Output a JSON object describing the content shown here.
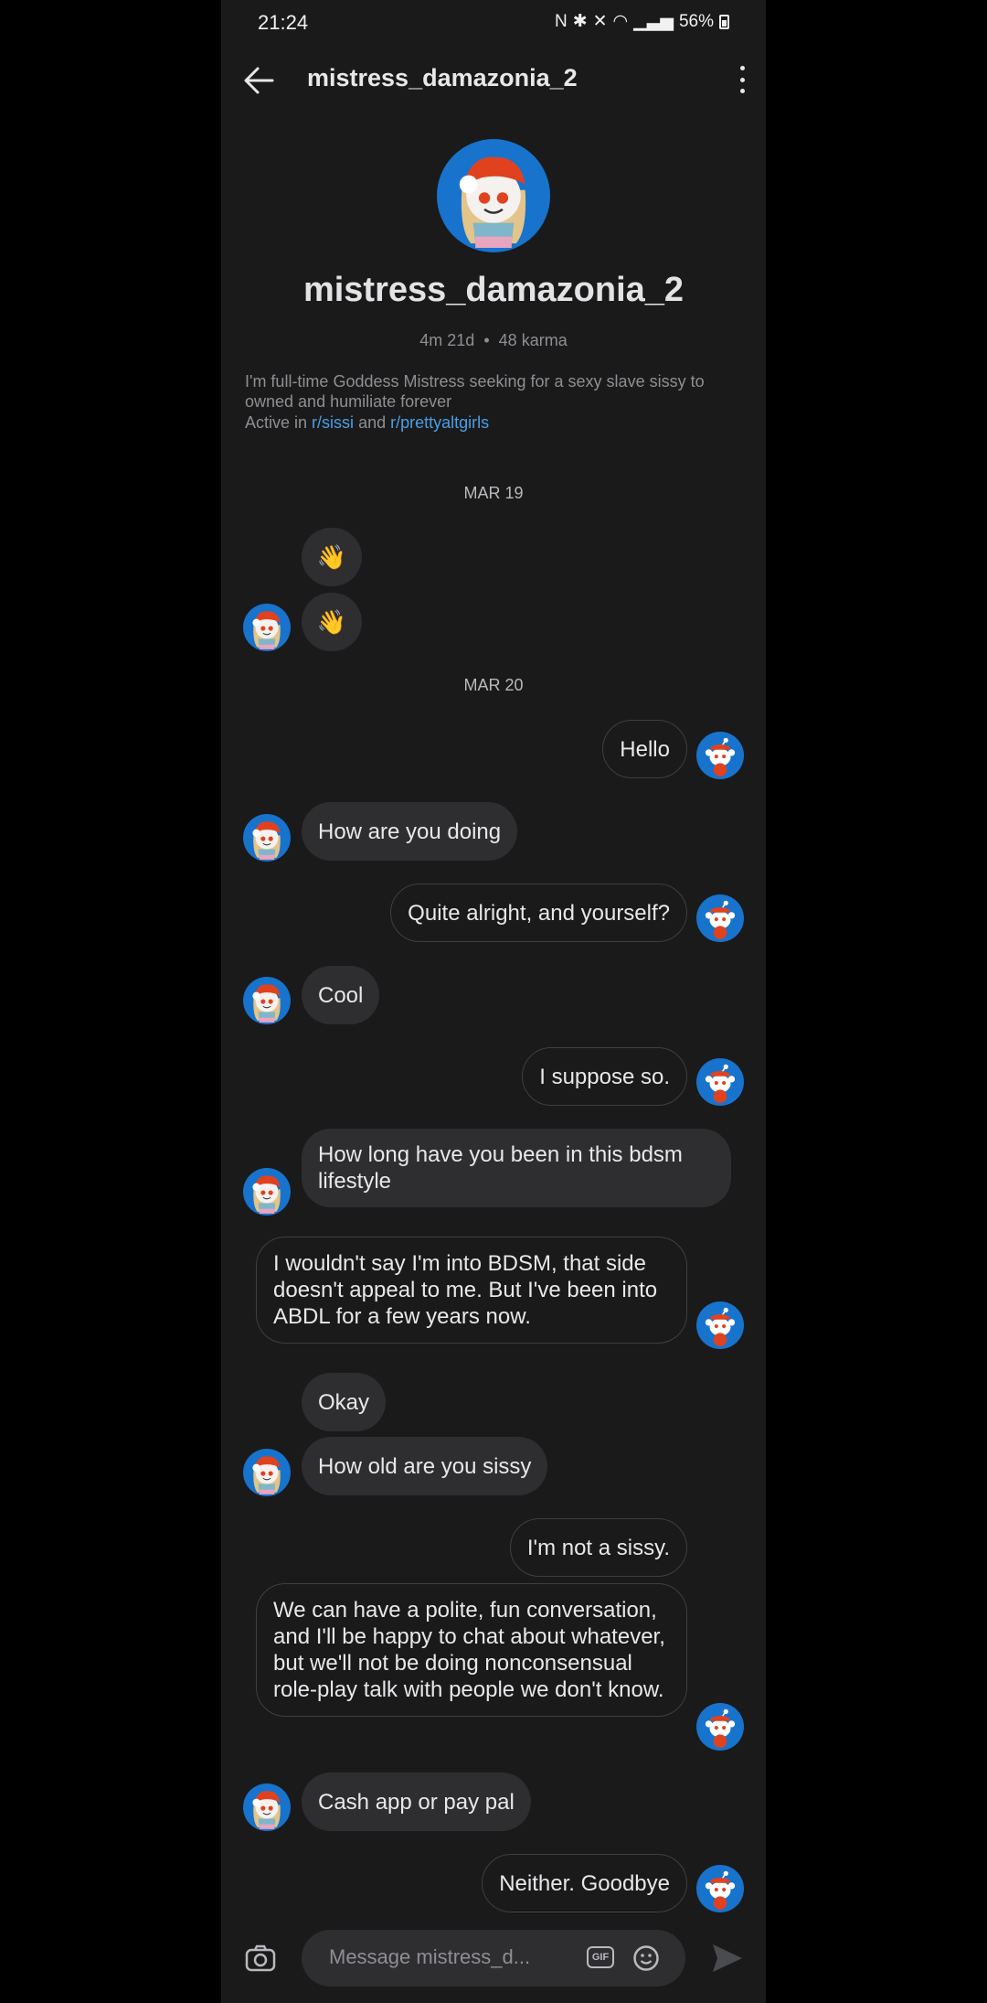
{
  "status": {
    "time": "21:24",
    "battery": "56%"
  },
  "header": {
    "title": "mistress_damazonia_2"
  },
  "profile": {
    "name": "mistress_damazonia_2",
    "age": "4m 21d",
    "separator": "•",
    "karma": "48 karma",
    "bio": "I'm full-time Goddess Mistress seeking for a sexy slave sissy to owned and humiliate forever",
    "active_prefix": "Active in",
    "active_sub1": "r/sissi",
    "active_and": "and",
    "active_sub2": "r/prettyaltgirls"
  },
  "dates": [
    "MAR 19",
    "MAR 20"
  ],
  "messages": [
    {
      "from": "them",
      "text": "👋"
    },
    {
      "from": "them",
      "text": "👋"
    },
    {
      "from": "me",
      "text": "Hello"
    },
    {
      "from": "them",
      "text": "How are you doing"
    },
    {
      "from": "me",
      "text": "Quite alright, and yourself?"
    },
    {
      "from": "them",
      "text": "Cool"
    },
    {
      "from": "me",
      "text": "I suppose so."
    },
    {
      "from": "them",
      "text": "How long have you been in this bdsm lifestyle"
    },
    {
      "from": "me",
      "text": "I wouldn't say I'm into BDSM, that side doesn't appeal to me. But I've been into ABDL for a few years now."
    },
    {
      "from": "them",
      "text": "Okay"
    },
    {
      "from": "them",
      "text": "How old are you sissy"
    },
    {
      "from": "me",
      "text": "I'm not a sissy."
    },
    {
      "from": "me",
      "text": "We can have a polite, fun conversation, and I'll be happy to chat about whatever, but we'll not be doing nonconsensual role-play talk with people we don't know."
    },
    {
      "from": "them",
      "text": "Cash app or pay pal"
    },
    {
      "from": "me",
      "text": "Neither. Goodbye"
    }
  ],
  "composer": {
    "placeholder": "Message mistress_d...",
    "gif_label": "GIF"
  },
  "colors": {
    "bg": "#1a1a1b",
    "bubble_in": "#2e2e31",
    "outline": "#3e3f43",
    "link": "#4a9fe6",
    "avatar_blue": "#1873cc",
    "snoo_red": "#e0421f"
  },
  "icons": [
    "back-arrow-icon",
    "kebab-menu-icon",
    "camera-icon",
    "gif-icon",
    "emoji-icon",
    "send-icon"
  ]
}
